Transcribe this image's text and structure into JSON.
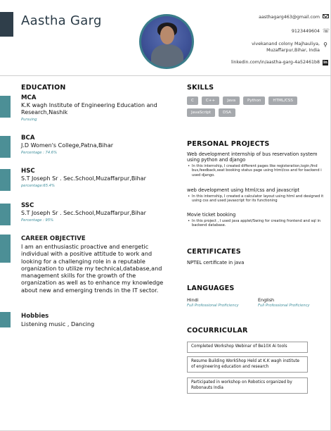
{
  "header": {
    "name": "Aastha Garg",
    "contact": {
      "email": "aasthagarg463@gmail.com",
      "phone": "9123449604",
      "address_line1": "vivekanand colony Majhauliya,",
      "address_line2": "Muzaffarpur,Bihar, India",
      "linkedin": "linkedin.com/in/aastha-garg-4a52461b8",
      "icons": [
        "mail-icon",
        "phone-icon",
        "location-icon",
        "linkedin-icon"
      ]
    }
  },
  "education": {
    "title": "EDUCATION",
    "items": [
      {
        "degree": "MCA",
        "institution": "K.K wagh Institute of Engineering Education and Research,Nashik",
        "meta": "Pursuing"
      },
      {
        "degree": "BCA",
        "institution": "J.D Women's College,Patna,Bihar",
        "meta": "Percentage : 74.6%"
      },
      {
        "degree": "HSC",
        "institution": "S.T Joseph Sr . Sec.School,Muzaffarpur,Bihar",
        "meta": "percentage:65.4%"
      },
      {
        "degree": "SSC",
        "institution": "S.T Joseph Sr . Sec.School,Muzaffarpur,Bihar",
        "meta": "Percentage : 95%"
      }
    ]
  },
  "objective": {
    "title": "CAREER OBJECTIVE",
    "text": "I am an enthusiastic proactive and energetic individual with a positive attitude to work and looking for a challenging role in a reputable organization to utilize my technical,database,and management skills for the growth of the organization as well as to enhance my knowledge about new and emerging trends in the IT sector."
  },
  "hobbies": {
    "title": "Hobbies",
    "text": "Listening music , Dancing"
  },
  "skills": {
    "title": "SKILLS",
    "items": [
      "C",
      "C++",
      "Java",
      "Python",
      "HTML/CSS",
      "JavaScript",
      "DSA"
    ]
  },
  "projects": {
    "title": "PERSONAL PROJECTS",
    "items": [
      {
        "head": "Web development internship of bus reservation system using python and django",
        "bullet": "In this internship, I created different pages like registeration,login,find bus,feedback,seat booking status page using html/css and for backend i used django."
      },
      {
        "head": "web development using html/css and javascript",
        "bullet": "In this internship, I created a calculator layout using html and designed it using css and used javascript for its functioning"
      },
      {
        "head": "Movie ticket booking",
        "bullet": "In this project , I used java applet/Swing for creating frontend and sql in backend database."
      }
    ]
  },
  "certificates": {
    "title": "CERTIFICATES",
    "text": "NPTEL certificate in java"
  },
  "languages": {
    "title": "LANGUAGES",
    "items": [
      {
        "name": "Hindi",
        "level": "Full Professional Proficiency"
      },
      {
        "name": "English",
        "level": "Full Professional Proficiency"
      }
    ]
  },
  "cocurricular": {
    "title": "COCURRICULAR",
    "items": [
      "Completed Workshop Webinar of Be10X Ai tools",
      "Resume Building WorkShop Held at K.K wagh institute of engineering education and research",
      "Participated in workshop on Robotics organized by Robonauts India"
    ]
  },
  "colors": {
    "accent": "#4c8f96",
    "name_bar": "#2f3e4a",
    "chip": "#a6a9ad",
    "italic_meta": "#3f8f9c"
  }
}
